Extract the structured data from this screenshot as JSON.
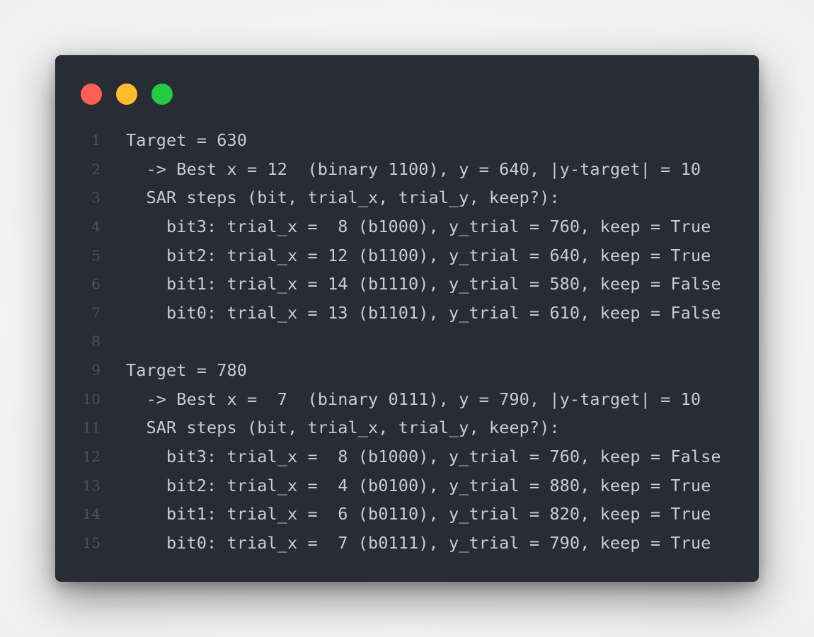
{
  "window": {
    "background": "#282c34",
    "text_color": "#c8ccd4",
    "line_number_color": "#4b5263",
    "controls": [
      {
        "name": "close-button",
        "color": "#ff5f56"
      },
      {
        "name": "minimize-button",
        "color": "#ffbd2e"
      },
      {
        "name": "maximize-button",
        "color": "#27c93f"
      }
    ]
  },
  "code": {
    "lines": [
      {
        "number": "1",
        "text": "Target = 630"
      },
      {
        "number": "2",
        "text": "  -> Best x = 12  (binary 1100), y = 640, |y-target| = 10"
      },
      {
        "number": "3",
        "text": "  SAR steps (bit, trial_x, trial_y, keep?):"
      },
      {
        "number": "4",
        "text": "    bit3: trial_x =  8 (b1000), y_trial = 760, keep = True"
      },
      {
        "number": "5",
        "text": "    bit2: trial_x = 12 (b1100), y_trial = 640, keep = True"
      },
      {
        "number": "6",
        "text": "    bit1: trial_x = 14 (b1110), y_trial = 580, keep = False"
      },
      {
        "number": "7",
        "text": "    bit0: trial_x = 13 (b1101), y_trial = 610, keep = False"
      },
      {
        "number": "8",
        "text": ""
      },
      {
        "number": "9",
        "text": "Target = 780"
      },
      {
        "number": "10",
        "text": "  -> Best x =  7  (binary 0111), y = 790, |y-target| = 10"
      },
      {
        "number": "11",
        "text": "  SAR steps (bit, trial_x, trial_y, keep?):"
      },
      {
        "number": "12",
        "text": "    bit3: trial_x =  8 (b1000), y_trial = 760, keep = False"
      },
      {
        "number": "13",
        "text": "    bit2: trial_x =  4 (b0100), y_trial = 880, keep = True"
      },
      {
        "number": "14",
        "text": "    bit1: trial_x =  6 (b0110), y_trial = 820, keep = True"
      },
      {
        "number": "15",
        "text": "    bit0: trial_x =  7 (b0111), y_trial = 790, keep = True"
      }
    ]
  }
}
